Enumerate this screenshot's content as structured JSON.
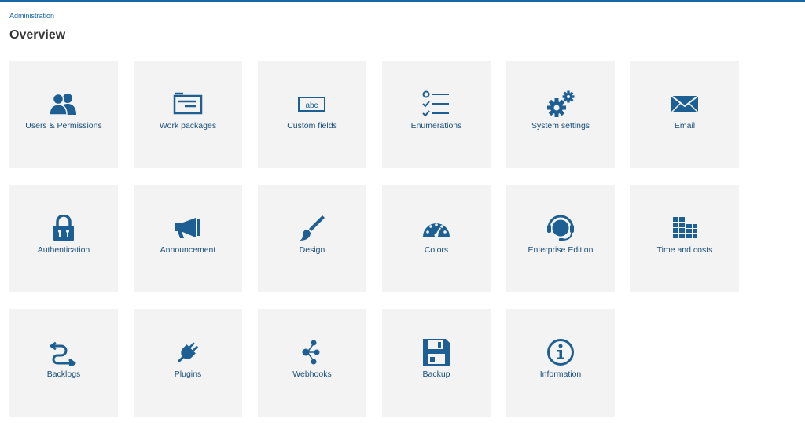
{
  "breadcrumb": "Administration",
  "title": "Overview",
  "accent_color": "#1a67a3",
  "icon_color": "#1d5f92",
  "tile_background": "#f3f3f3",
  "tiles": [
    {
      "label": "Users & Permissions",
      "icon": "users-icon"
    },
    {
      "label": "Work packages",
      "icon": "work-packages-icon"
    },
    {
      "label": "Custom fields",
      "icon": "custom-fields-icon"
    },
    {
      "label": "Enumerations",
      "icon": "enumerations-icon"
    },
    {
      "label": "System settings",
      "icon": "settings-gears-icon"
    },
    {
      "label": "Email",
      "icon": "envelope-icon"
    },
    {
      "label": "Authentication",
      "icon": "lock-icon"
    },
    {
      "label": "Announcement",
      "icon": "megaphone-icon"
    },
    {
      "label": "Design",
      "icon": "paintbrush-icon"
    },
    {
      "label": "Colors",
      "icon": "gauge-icon"
    },
    {
      "label": "Enterprise Edition",
      "icon": "headset-icon"
    },
    {
      "label": "Time and costs",
      "icon": "time-costs-icon"
    },
    {
      "label": "Backlogs",
      "icon": "backlogs-icon"
    },
    {
      "label": "Plugins",
      "icon": "plug-icon"
    },
    {
      "label": "Webhooks",
      "icon": "webhooks-icon"
    },
    {
      "label": "Backup",
      "icon": "floppy-disk-icon"
    },
    {
      "label": "Information",
      "icon": "info-icon"
    }
  ]
}
